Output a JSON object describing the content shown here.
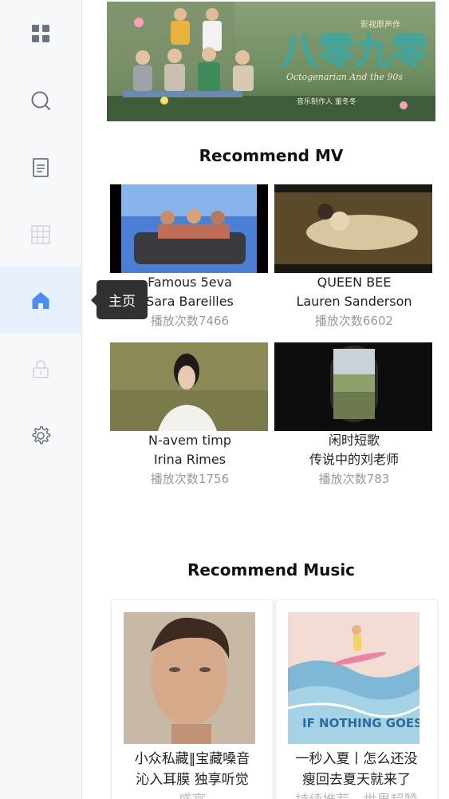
{
  "sidebar": {
    "items": [
      {
        "name": "apps",
        "icon": "grid-icon"
      },
      {
        "name": "search",
        "icon": "search-icon"
      },
      {
        "name": "document",
        "icon": "document-icon"
      },
      {
        "name": "table",
        "icon": "table-icon"
      },
      {
        "name": "home",
        "icon": "home-icon",
        "active": true
      },
      {
        "name": "lock",
        "icon": "lock-icon"
      },
      {
        "name": "settings",
        "icon": "gear-icon"
      }
    ],
    "tooltip": "主页",
    "active_color": "#4a8ef2",
    "icon_color": "#6b7280"
  },
  "banner": {
    "title_cn": "八零九零",
    "title_en": "Octogenarian And the 90s",
    "tag": "影视原声作",
    "credit": "音乐制作人 董冬冬"
  },
  "recommend_mv": {
    "title": "Recommend MV",
    "items": [
      {
        "title": "Famous 5eva",
        "artist": "Sara Bareilles",
        "plays": "播放次数7466"
      },
      {
        "title": "QUEEN BEE",
        "artist": "Lauren Sanderson",
        "plays": "播放次数6602"
      },
      {
        "title": "N-avem timp",
        "artist": "Irina Rimes",
        "plays": "播放次数1756"
      },
      {
        "title": "闲时短歌",
        "artist": "传说中的刘老师",
        "plays": "播放次数783"
      }
    ]
  },
  "recommend_music": {
    "title": "Recommend Music",
    "items": [
      {
        "line1": "小众私藏‖宝藏嗓音",
        "line2": "沁入耳膜 独享听觉",
        "line3": "盛宴"
      },
      {
        "line1": "一秒入夏丨怎么还没",
        "line2": "瘦回去夏天就来了",
        "line3": "持续推荐，世界超赞",
        "cover_text": "IF NOTHING GOES RIGHT,"
      }
    ]
  }
}
